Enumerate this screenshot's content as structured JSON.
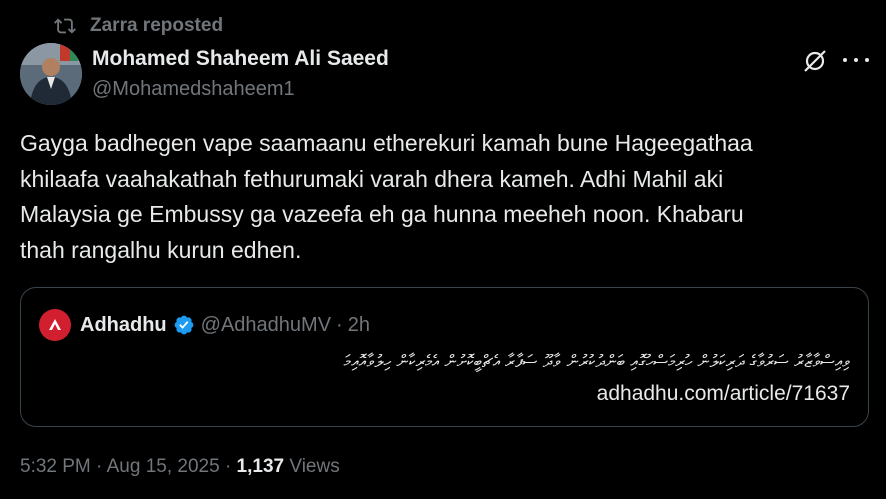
{
  "repost": {
    "label": "Zarra reposted",
    "icon": "repost-icon"
  },
  "author": {
    "name": "Mohamed Shaheem Ali Saeed",
    "handle": "@Mohamedshaheem1",
    "avatar": "avatar"
  },
  "actions": {
    "grok_icon": "grok-icon",
    "more_icon": "more-icon"
  },
  "tweet": {
    "text_lines": [
      "Gayga badhegen vape saamaanu etherekuri kamah bune Hageegathaa",
      "khilaafa vaahakathah fethurumaki varah dhera kameh. Adhi Mahil aki",
      "Malaysia ge Embussy ga vazeefa eh ga hunna meeheh noon. Khabaru",
      "thah rangalhu kurun edhen."
    ]
  },
  "quote": {
    "name": "Adhadhu",
    "handle": "@AdhadhuMV",
    "separator": "·",
    "time": "2h",
    "text": "ވިއިސްވާޒާރު ސަރުވާގެ ދަރިކަލުން ހުރިމަސްހުގޮއި ބަންދުކުރުން ވާދޫ ސަފާރާ އެޗްބީކޮށުން އެމެރިކާން ހިލުވާއޮއިމަ",
    "link": "adhadhu.com/article/71637",
    "verified_icon": "verified-badge-icon",
    "logo": "adhadhu-logo"
  },
  "meta": {
    "time": "5:32 PM",
    "sep1": "·",
    "date": "Aug 15, 2025",
    "sep2": "·",
    "views_count": "1,137",
    "views_label": "Views"
  },
  "colors": {
    "background": "#000000",
    "text": "#e7e9ea",
    "muted": "#71767b",
    "border": "#38444d",
    "verified": "#1d9bf0",
    "adhadhu_red": "#d21f30"
  }
}
